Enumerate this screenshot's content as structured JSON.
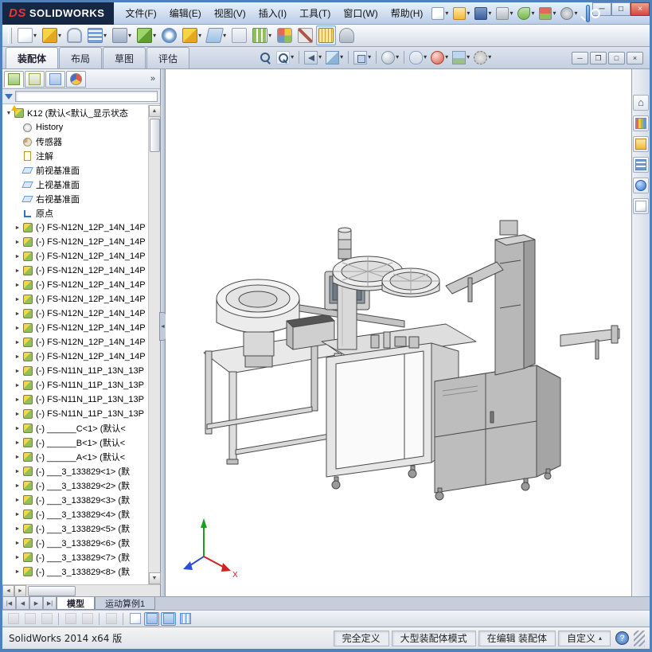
{
  "glyphs": {
    "dd": "▾",
    "collapsed": "►",
    "expanded": "▼",
    "up": "▲",
    "down": "▼",
    "left": "◄",
    "right": "►",
    "chevron": "»"
  },
  "titlebar": {
    "logo_mark": "DS",
    "logo_text": "SOLIDWORKS",
    "menus": [
      {
        "name": "menu-file",
        "label": "文件(F)"
      },
      {
        "name": "menu-edit",
        "label": "编辑(E)"
      },
      {
        "name": "menu-view",
        "label": "视图(V)"
      },
      {
        "name": "menu-insert",
        "label": "插入(I)"
      },
      {
        "name": "menu-tools",
        "label": "工具(T)"
      },
      {
        "name": "menu-window",
        "label": "窗口(W)"
      },
      {
        "name": "menu-help",
        "label": "帮助(H)"
      }
    ],
    "quick_icons": [
      {
        "name": "new-file-icon",
        "cls": "q-new",
        "dd": true
      },
      {
        "name": "open-icon",
        "cls": "q-open",
        "dd": true
      },
      {
        "name": "save-icon",
        "cls": "q-save",
        "dd": true
      },
      {
        "name": "print-icon",
        "cls": "q-print",
        "dd": true
      },
      {
        "name": "undo-icon",
        "cls": "q-undo",
        "dd": true
      },
      {
        "name": "rebuild-icon",
        "cls": "q-rebuild",
        "dd": true
      },
      {
        "name": "options-icon",
        "cls": "q-options",
        "dd": true
      }
    ],
    "window_buttons": [
      {
        "name": "minimize-button",
        "glyph": "─"
      },
      {
        "name": "maximize-button",
        "glyph": "□"
      },
      {
        "name": "close-button",
        "glyph": "×",
        "close": true
      }
    ]
  },
  "toolbar": {
    "items": [
      {
        "name": "edit-component-icon",
        "cls": "i-doc",
        "dd": true
      },
      {
        "name": "insert-components-icon",
        "cls": "i-cube-y",
        "dd": true
      },
      {
        "name": "mate-icon",
        "cls": "i-clip"
      },
      {
        "name": "linear-component-pattern-icon",
        "cls": "i-grid-b",
        "dd": true
      },
      {
        "name": "smart-fasteners-icon",
        "cls": "i-bolt",
        "dd": true
      },
      {
        "name": "move-component-icon",
        "cls": "i-cube-g",
        "dd": true
      },
      {
        "name": "show-hidden-components-icon",
        "cls": "i-eye"
      },
      {
        "name": "assembly-features-icon",
        "cls": "i-cube-y",
        "dd": true
      },
      {
        "name": "reference-geometry-icon",
        "cls": "i-plane-b",
        "dd": true
      },
      {
        "name": "new-motion-study-icon",
        "cls": "i-motion"
      },
      {
        "name": "bill-of-materials-icon",
        "cls": "i-table-g",
        "dd": true
      },
      {
        "name": "exploded-view-icon",
        "cls": "i-explode"
      },
      {
        "name": "interference-detection-icon",
        "cls": "i-x-gray"
      },
      {
        "name": "measure-icon",
        "cls": "i-ruler",
        "active": true
      },
      {
        "name": "mass-properties-icon",
        "cls": "i-scale"
      }
    ]
  },
  "commandmanager": {
    "tabs": [
      {
        "name": "assembly",
        "label": "装配体",
        "active": true
      },
      {
        "name": "layout",
        "label": "布局",
        "active": false
      },
      {
        "name": "sketch",
        "label": "草图",
        "active": false
      },
      {
        "name": "evaluate",
        "label": "评估",
        "active": false
      }
    ]
  },
  "viewtoolbar": {
    "items": [
      {
        "name": "zoom-to-fit-icon",
        "cls": "v-mag"
      },
      {
        "name": "zoom-to-area-icon",
        "cls": "v-magplus",
        "dd": true
      },
      {
        "sep": true
      },
      {
        "name": "previous-view-icon",
        "cls": "v-prev",
        "dd": true
      },
      {
        "name": "section-view-icon",
        "cls": "v-section",
        "dd": true
      },
      {
        "sep": true
      },
      {
        "name": "view-orientation-icon",
        "cls": "v-orient",
        "dd": true
      },
      {
        "sep": true
      },
      {
        "name": "display-style-icon",
        "cls": "v-display",
        "dd": true
      },
      {
        "sep": true
      },
      {
        "name": "hide-show-items-icon",
        "cls": "v-eye",
        "dd": true
      },
      {
        "name": "edit-appearance-icon",
        "cls": "v-appearance",
        "dd": true
      },
      {
        "name": "apply-scene-icon",
        "cls": "v-scene",
        "dd": true
      },
      {
        "name": "view-settings-icon",
        "cls": "v-settings",
        "dd": true
      }
    ]
  },
  "docbuttons": [
    {
      "name": "doc-minimize-button",
      "glyph": "─"
    },
    {
      "name": "doc-restore-button",
      "glyph": "❐"
    },
    {
      "name": "doc-maximize-button",
      "glyph": "□"
    },
    {
      "name": "doc-close-button",
      "glyph": "×"
    }
  ],
  "featurepanel": {
    "tabs": [
      {
        "name": "featuremanager-tree-tab",
        "cls": "p-fm",
        "active": true
      },
      {
        "name": "propertymanager-tab",
        "cls": "p-pm",
        "active": false
      },
      {
        "name": "configurationmanager-tab",
        "cls": "p-cm",
        "active": false
      },
      {
        "name": "displaymanager-tab",
        "cls": "p-dm",
        "active": false
      }
    ],
    "root": {
      "label": "K12 (默认<默认_显示状态",
      "icon": "assembly"
    },
    "items": [
      {
        "icon": "history",
        "label": "History"
      },
      {
        "icon": "sensors",
        "label": "传感器"
      },
      {
        "icon": "annotations",
        "label": "注解"
      },
      {
        "icon": "plane",
        "label": "前视基准面"
      },
      {
        "icon": "plane",
        "label": "上视基准面"
      },
      {
        "icon": "plane",
        "label": "右视基准面"
      },
      {
        "icon": "origin",
        "label": "原点"
      },
      {
        "icon": "component",
        "arrow": true,
        "label": "(-) FS-N12N_12P_14N_14P"
      },
      {
        "icon": "component",
        "arrow": true,
        "label": "(-) FS-N12N_12P_14N_14P"
      },
      {
        "icon": "component",
        "arrow": true,
        "label": "(-) FS-N12N_12P_14N_14P"
      },
      {
        "icon": "component",
        "arrow": true,
        "label": "(-) FS-N12N_12P_14N_14P"
      },
      {
        "icon": "component",
        "arrow": true,
        "label": "(-) FS-N12N_12P_14N_14P"
      },
      {
        "icon": "component",
        "arrow": true,
        "label": "(-) FS-N12N_12P_14N_14P"
      },
      {
        "icon": "component",
        "arrow": true,
        "label": "(-) FS-N12N_12P_14N_14P"
      },
      {
        "icon": "component",
        "arrow": true,
        "label": "(-) FS-N12N_12P_14N_14P"
      },
      {
        "icon": "component",
        "arrow": true,
        "label": "(-) FS-N12N_12P_14N_14P"
      },
      {
        "icon": "component",
        "arrow": true,
        "label": "(-) FS-N12N_12P_14N_14P"
      },
      {
        "icon": "component",
        "arrow": true,
        "label": "(-) FS-N11N_11P_13N_13P"
      },
      {
        "icon": "component",
        "arrow": true,
        "label": "(-) FS-N11N_11P_13N_13P"
      },
      {
        "icon": "component",
        "arrow": true,
        "label": "(-) FS-N11N_11P_13N_13P"
      },
      {
        "icon": "component",
        "arrow": true,
        "label": "(-) FS-N11N_11P_13N_13P"
      },
      {
        "icon": "component",
        "arrow": true,
        "label": "(-) ______C<1> (默认<"
      },
      {
        "icon": "component",
        "arrow": true,
        "label": "(-) ______B<1> (默认<"
      },
      {
        "icon": "component",
        "arrow": true,
        "label": "(-) ______A<1> (默认<"
      },
      {
        "icon": "component",
        "arrow": true,
        "label": "(-) ___3_133829<1> (默"
      },
      {
        "icon": "component",
        "arrow": true,
        "label": "(-) ___3_133829<2> (默"
      },
      {
        "icon": "component",
        "arrow": true,
        "label": "(-) ___3_133829<3> (默"
      },
      {
        "icon": "component",
        "arrow": true,
        "label": "(-) ___3_133829<4> (默"
      },
      {
        "icon": "component",
        "arrow": true,
        "label": "(-) ___3_133829<5> (默"
      },
      {
        "icon": "component",
        "arrow": true,
        "label": "(-) ___3_133829<6> (默"
      },
      {
        "icon": "component",
        "arrow": true,
        "label": "(-) ___3_133829<7> (默"
      },
      {
        "icon": "component",
        "arrow": true,
        "label": "(-) ___3_133829<8> (默"
      }
    ]
  },
  "taskpane": [
    {
      "name": "solidworks-resources-icon",
      "cls": "tp-home",
      "glyph": "⌂"
    },
    {
      "name": "design-library-icon",
      "cls": "tp-lib",
      "glyph": ""
    },
    {
      "name": "file-explorer-icon",
      "cls": "tp-folder",
      "glyph": ""
    },
    {
      "name": "view-palette-icon",
      "cls": "tp-pal",
      "glyph": ""
    },
    {
      "name": "appearances-icon",
      "cls": "tp-app",
      "glyph": ""
    },
    {
      "name": "custom-properties-icon",
      "cls": "tp-prop",
      "glyph": ""
    }
  ],
  "doctabs": {
    "nav": [
      "|◀",
      "◀",
      "▶",
      "▶|"
    ],
    "tabs": [
      {
        "name": "tab-model",
        "label": "模型",
        "active": true
      },
      {
        "name": "tab-motion-study-1",
        "label": "运动算例1",
        "active": false
      }
    ]
  },
  "bottombar": {
    "items": [
      {
        "name": "filter-vertices-icon",
        "cls": "b-gray",
        "disabled": true
      },
      {
        "name": "filter-edges-icon",
        "cls": "b-gray",
        "disabled": true
      },
      {
        "name": "filter-faces-icon",
        "cls": "b-gray",
        "disabled": true
      },
      {
        "sep": true
      },
      {
        "name": "toggle-selection-filter-icon",
        "cls": "b-gray",
        "disabled": true
      },
      {
        "name": "clear-all-filters-icon",
        "cls": "b-gray",
        "disabled": true
      },
      {
        "sep": true
      },
      {
        "name": "select-all-filters-icon",
        "cls": "b-gray",
        "disabled": true
      },
      {
        "sep": true
      },
      {
        "name": "quick-snaps-icon",
        "cls": "b-doc"
      },
      {
        "name": "section-view-toggle-icon",
        "cls": "b-blue",
        "active": true
      },
      {
        "name": "display-pane-icon",
        "cls": "b-blue",
        "active": true
      },
      {
        "name": "view-grid-icon",
        "cls": "b-grid"
      }
    ]
  },
  "statusbar": {
    "left": "SolidWorks 2014 x64 版",
    "cells": [
      "完全定义",
      "大型装配体模式",
      "在编辑 装配体"
    ],
    "custom_label": "自定义",
    "custom_arrow": "▴",
    "help_glyph": "?"
  },
  "triad": {
    "x_label": "X"
  },
  "accent_colors": {
    "frame": "#4f81bd",
    "logo_bg": "#152744",
    "close_red": "#d64541"
  }
}
